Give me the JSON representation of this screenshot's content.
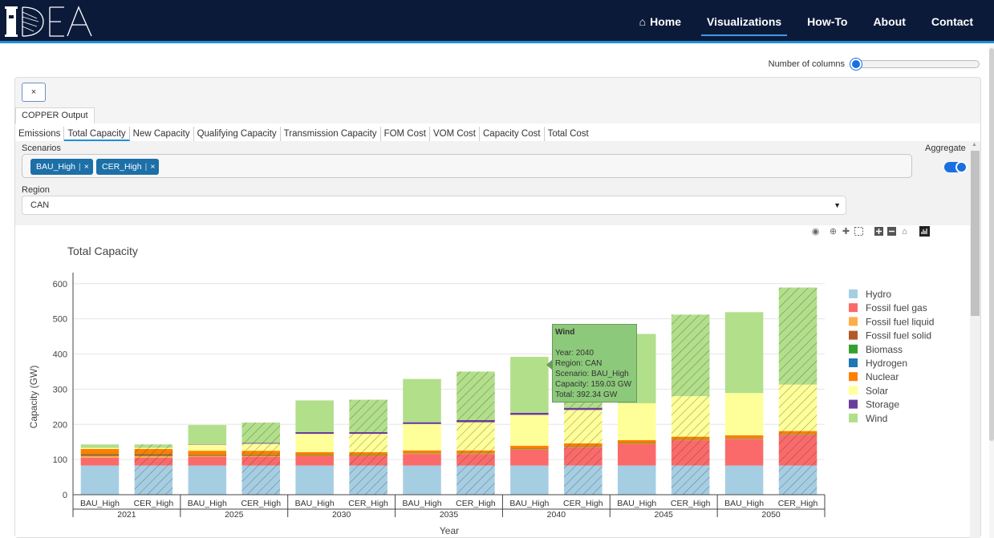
{
  "nav": {
    "items": [
      {
        "label": "Home",
        "icon": "home-icon",
        "active": false
      },
      {
        "label": "Visualizations",
        "active": true
      },
      {
        "label": "How-To",
        "active": false
      },
      {
        "label": "About",
        "active": false
      },
      {
        "label": "Contact",
        "active": false
      }
    ]
  },
  "columns": {
    "label": "Number of columns"
  },
  "panel": {
    "close_label": "×",
    "outer_tab": "COPPER Output",
    "tabs": [
      "Emissions",
      "Total Capacity",
      "New Capacity",
      "Qualifying Capacity",
      "Transmission Capacity",
      "FOM Cost",
      "VOM Cost",
      "Capacity Cost",
      "Total Cost"
    ],
    "active_tab": "Total Capacity",
    "scenarios_label": "Scenarios",
    "scenarios": [
      "BAU_High",
      "CER_High"
    ],
    "chip_remove": "×",
    "aggregate_label": "Aggregate",
    "region_label": "Region",
    "region_value": "CAN"
  },
  "colors": {
    "Hydro": "#a6cee3",
    "Fossil fuel gas": "#fb6a6a",
    "Fossil fuel liquid": "#fdae4b",
    "Fossil fuel solid": "#b15928",
    "Biomass": "#33a02c",
    "Hydrogen": "#1f78b4",
    "Nuclear": "#ff7f00",
    "Solar": "#ffff99",
    "Storage": "#6a3d9a",
    "Wind": "#b2df8a"
  },
  "chart_data": {
    "type": "bar",
    "title": "Total Capacity",
    "xlabel": "Year",
    "ylabel": "Capacity (GW)",
    "ylim": [
      0,
      620
    ],
    "yticks": [
      0,
      100,
      200,
      300,
      400,
      500,
      600
    ],
    "years": [
      "2021",
      "2025",
      "2030",
      "2035",
      "2040",
      "2045",
      "2050"
    ],
    "scenarios": [
      "BAU_High",
      "CER_High"
    ],
    "hatched_scenario": "CER_High",
    "series_order": [
      "Hydro",
      "Fossil fuel gas",
      "Fossil fuel liquid",
      "Fossil fuel solid",
      "Biomass",
      "Hydrogen",
      "Nuclear",
      "Solar",
      "Storage",
      "Wind"
    ],
    "legend": [
      "Hydro",
      "Fossil fuel gas",
      "Fossil fuel liquid",
      "Fossil fuel solid",
      "Biomass",
      "Hydrogen",
      "Nuclear",
      "Solar",
      "Storage",
      "Wind"
    ],
    "bars": [
      {
        "year": "2021",
        "scenario": "BAU_High",
        "values": {
          "Hydro": 83,
          "Fossil fuel gas": 22,
          "Fossil fuel liquid": 5,
          "Fossil fuel solid": 5,
          "Biomass": 1,
          "Hydrogen": 0,
          "Nuclear": 14,
          "Solar": 3,
          "Storage": 0,
          "Wind": 10
        }
      },
      {
        "year": "2021",
        "scenario": "CER_High",
        "values": {
          "Hydro": 83,
          "Fossil fuel gas": 22,
          "Fossil fuel liquid": 5,
          "Fossil fuel solid": 5,
          "Biomass": 1,
          "Hydrogen": 0,
          "Nuclear": 14,
          "Solar": 3,
          "Storage": 0,
          "Wind": 10
        }
      },
      {
        "year": "2025",
        "scenario": "BAU_High",
        "values": {
          "Hydro": 83,
          "Fossil fuel gas": 25,
          "Fossil fuel liquid": 2,
          "Fossil fuel solid": 2,
          "Biomass": 1,
          "Hydrogen": 0,
          "Nuclear": 12,
          "Solar": 18,
          "Storage": 1,
          "Wind": 54
        }
      },
      {
        "year": "2025",
        "scenario": "CER_High",
        "values": {
          "Hydro": 83,
          "Fossil fuel gas": 25,
          "Fossil fuel liquid": 2,
          "Fossil fuel solid": 2,
          "Biomass": 1,
          "Hydrogen": 0,
          "Nuclear": 12,
          "Solar": 20,
          "Storage": 2,
          "Wind": 58
        }
      },
      {
        "year": "2030",
        "scenario": "BAU_High",
        "values": {
          "Hydro": 83,
          "Fossil fuel gas": 27,
          "Fossil fuel liquid": 1,
          "Fossil fuel solid": 1,
          "Biomass": 1,
          "Hydrogen": 0,
          "Nuclear": 8,
          "Solar": 52,
          "Storage": 5,
          "Wind": 90
        }
      },
      {
        "year": "2030",
        "scenario": "CER_High",
        "values": {
          "Hydro": 83,
          "Fossil fuel gas": 27,
          "Fossil fuel liquid": 1,
          "Fossil fuel solid": 1,
          "Biomass": 1,
          "Hydrogen": 0,
          "Nuclear": 8,
          "Solar": 52,
          "Storage": 5,
          "Wind": 92
        }
      },
      {
        "year": "2035",
        "scenario": "BAU_High",
        "values": {
          "Hydro": 83,
          "Fossil fuel gas": 33,
          "Fossil fuel liquid": 1,
          "Fossil fuel solid": 0,
          "Biomass": 1,
          "Hydrogen": 0,
          "Nuclear": 8,
          "Solar": 75,
          "Storage": 5,
          "Wind": 123
        }
      },
      {
        "year": "2035",
        "scenario": "CER_High",
        "values": {
          "Hydro": 83,
          "Fossil fuel gas": 33,
          "Fossil fuel liquid": 1,
          "Fossil fuel solid": 0,
          "Biomass": 1,
          "Hydrogen": 0,
          "Nuclear": 8,
          "Solar": 80,
          "Storage": 6,
          "Wind": 138
        }
      },
      {
        "year": "2040",
        "scenario": "BAU_High",
        "values": {
          "Hydro": 83,
          "Fossil fuel gas": 46,
          "Fossil fuel liquid": 1,
          "Fossil fuel solid": 0,
          "Biomass": 1,
          "Hydrogen": 0,
          "Nuclear": 8,
          "Solar": 88,
          "Storage": 6,
          "Wind": 159.03
        }
      },
      {
        "year": "2040",
        "scenario": "CER_High",
        "values": {
          "Hydro": 83,
          "Fossil fuel gas": 53,
          "Fossil fuel liquid": 1,
          "Fossil fuel solid": 0,
          "Biomass": 1,
          "Hydrogen": 0,
          "Nuclear": 8,
          "Solar": 95,
          "Storage": 6,
          "Wind": 150
        }
      },
      {
        "year": "2045",
        "scenario": "BAU_High",
        "values": {
          "Hydro": 83,
          "Fossil fuel gas": 62,
          "Fossil fuel liquid": 1,
          "Fossil fuel solid": 0,
          "Biomass": 1,
          "Hydrogen": 0,
          "Nuclear": 8,
          "Solar": 105,
          "Storage": 0,
          "Wind": 197
        }
      },
      {
        "year": "2045",
        "scenario": "CER_High",
        "values": {
          "Hydro": 83,
          "Fossil fuel gas": 72,
          "Fossil fuel liquid": 1,
          "Fossil fuel solid": 0,
          "Biomass": 1,
          "Hydrogen": 0,
          "Nuclear": 8,
          "Solar": 115,
          "Storage": 0,
          "Wind": 232
        }
      },
      {
        "year": "2050",
        "scenario": "BAU_High",
        "values": {
          "Hydro": 83,
          "Fossil fuel gas": 76,
          "Fossil fuel liquid": 1,
          "Fossil fuel solid": 0,
          "Biomass": 1,
          "Hydrogen": 0,
          "Nuclear": 8,
          "Solar": 120,
          "Storage": 0,
          "Wind": 230
        }
      },
      {
        "year": "2050",
        "scenario": "CER_High",
        "values": {
          "Hydro": 83,
          "Fossil fuel gas": 88,
          "Fossil fuel liquid": 1,
          "Fossil fuel solid": 0,
          "Biomass": 1,
          "Hydrogen": 0,
          "Nuclear": 8,
          "Solar": 132,
          "Storage": 0,
          "Wind": 276
        }
      }
    ],
    "grid": true,
    "legend_position": "right"
  },
  "tooltip": {
    "title": "Wind",
    "lines": [
      "Year: 2040",
      "Region: CAN",
      "Scenario: BAU_High",
      "Capacity: 159.03 GW",
      "Total: 392.34 GW"
    ]
  }
}
